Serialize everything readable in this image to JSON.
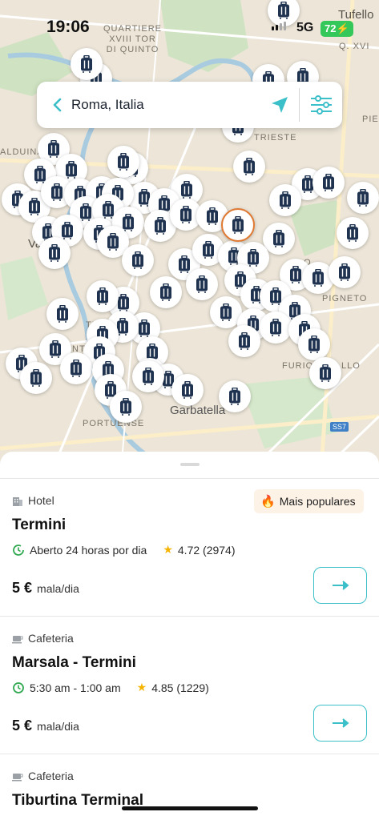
{
  "status_bar": {
    "time": "19:06",
    "network": "5G",
    "battery": "72"
  },
  "search": {
    "location": "Roma, Italia"
  },
  "map": {
    "labels": [
      {
        "text": "QUARTIERE\nXVIII TOR\nDI QUINTO"
      },
      {
        "text": "Tufello"
      },
      {
        "text": "Q. XVI"
      },
      {
        "text": "TRIESTE"
      },
      {
        "text": "PIE"
      },
      {
        "text": "ALDUINA"
      },
      {
        "text": "PIGNETO"
      },
      {
        "text": "FURIO"
      },
      {
        "text": "LLO"
      },
      {
        "text": "LO"
      },
      {
        "text": "Garbatella"
      },
      {
        "text": "PORTUENSE"
      },
      {
        "text": "TR"
      },
      {
        "text": "NT"
      },
      {
        "text": "Va"
      },
      {
        "text": "SS7"
      }
    ],
    "pin_icon": "luggage-icon",
    "accent": "#1f3350",
    "selected_color": "#e07a33"
  },
  "listings": [
    {
      "type": "Hotel",
      "type_icon": "building-icon",
      "badge": "Mais populares",
      "name": "Termini",
      "hours": "Aberto 24 horas por dia",
      "rating": "4.72 (2974)",
      "price": "5 €",
      "price_unit": "mala/dia"
    },
    {
      "type": "Cafeteria",
      "type_icon": "cup-icon",
      "name": "Marsala - Termini",
      "hours": "5:30 am - 1:00 am",
      "rating": "4.85 (1229)",
      "price": "5 €",
      "price_unit": "mala/dia"
    },
    {
      "type": "Cafeteria",
      "type_icon": "cup-icon",
      "name": "Tiburtina Terminal"
    }
  ],
  "colors": {
    "teal": "#3bbfc8",
    "green": "#2fa84f",
    "star": "#f5b400",
    "badge_bg": "#fdf2e6"
  }
}
